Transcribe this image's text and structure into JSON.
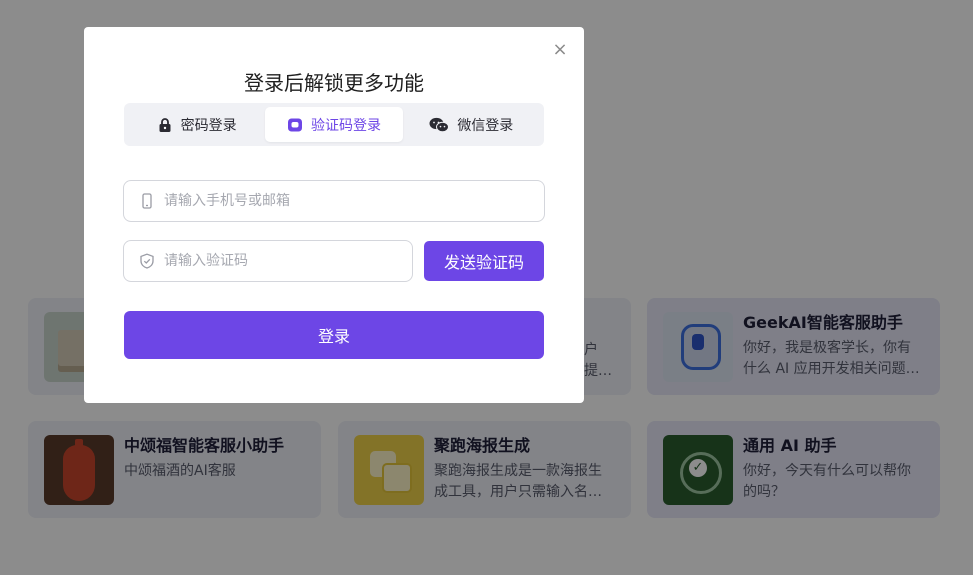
{
  "modal": {
    "title": "登录后解锁更多功能",
    "close_icon": "×"
  },
  "tabs": [
    {
      "label": "密码登录",
      "icon": "lock-icon",
      "active": false
    },
    {
      "label": "验证码登录",
      "icon": "message-icon",
      "active": true
    },
    {
      "label": "微信登录",
      "icon": "wechat-icon",
      "active": false
    }
  ],
  "form": {
    "phone_placeholder": "请输入手机号或邮箱",
    "phone_icon": "phone-icon",
    "code_placeholder": "请输入验证码",
    "code_icon": "shield-icon",
    "send_code_label": "发送验证码",
    "login_label": "登录"
  },
  "apps": [
    {
      "title": "",
      "desc": "",
      "thumb": "box-thumbnail"
    },
    {
      "title": "",
      "desc": "户提…",
      "thumb": ""
    },
    {
      "title": "GeekAI智能客服助手",
      "desc": "你好，我是极客学长，你有什么 AI 应用开发相关问题…",
      "thumb": "robot-thumbnail"
    },
    {
      "title": "中颂福智能客服小助手",
      "desc": "中颂福酒的AI客服",
      "thumb": "vase-thumbnail"
    },
    {
      "title": "聚跑海报生成",
      "desc": "聚跑海报生成是一款海报生成工具，用户只需输入名…",
      "thumb": "poster-thumbnail"
    },
    {
      "title": "通用 AI 助手",
      "desc": "你好，今天有什么可以帮你的吗？",
      "thumb": "gpt-thumbnail"
    }
  ],
  "colors": {
    "accent": "#6d46e6",
    "overlay": "rgba(0,0,0,0.45)"
  }
}
